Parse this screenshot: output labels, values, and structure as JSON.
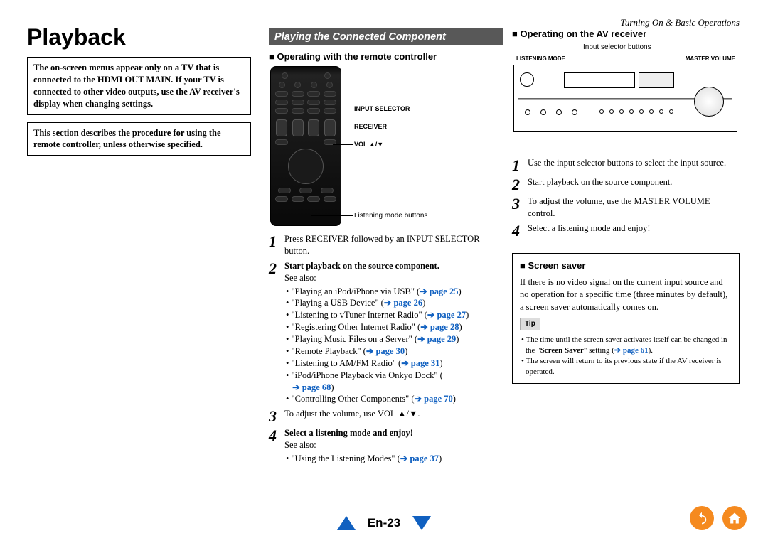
{
  "header": {
    "breadcrumb": "Turning On & Basic Operations"
  },
  "title": "Playback",
  "col1": {
    "box1_a": "The on-screen menus appear only on a TV that is connected to the ",
    "box1_b": "HDMI OUT MAIN",
    "box1_c": ". If your TV is connected to other video outputs, use the AV receiver's display when changing settings.",
    "box2": "This section describes the procedure for using the remote controller, unless otherwise specified."
  },
  "col2": {
    "section_title": "Playing the Connected Component",
    "subheading": "Operating with the remote controller",
    "callouts": {
      "input_selector": "INPUT SELECTOR",
      "receiver": "RECEIVER",
      "vol": "VOL ▲/▼",
      "listening": "Listening mode buttons"
    },
    "steps": [
      {
        "bold_a": "Press ",
        "bold_b": "RECEIVER",
        "bold_c": " followed by an ",
        "bold_d": "INPUT SELECTOR",
        "bold_e": " button."
      },
      {
        "bold": "Start playback on the source component.",
        "after": "See also:",
        "links": [
          {
            "text": "\"Playing an iPod/iPhone via USB\" (",
            "p": "page 25",
            "close": ")"
          },
          {
            "text": "\"Playing a USB Device\" (",
            "p": "page 26",
            "close": ")"
          },
          {
            "text": "\"Listening to vTuner Internet Radio\" (",
            "p": "page 27",
            "close": ")"
          },
          {
            "text": "\"Registering Other Internet Radio\" (",
            "p": "page 28",
            "close": ")"
          },
          {
            "text": "\"Playing Music Files on a Server\" (",
            "p": "page 29",
            "close": ")"
          },
          {
            "text": "\"Remote Playback\" (",
            "p": "page 30",
            "close": ")"
          },
          {
            "text": "\"Listening to AM/FM Radio\" (",
            "p": "page 31",
            "close": ")"
          },
          {
            "text": "\"iPod/iPhone Playback via Onkyo Dock\" (",
            "p": "page 68",
            "close": ")"
          },
          {
            "text": "\"Controlling Other Components\" (",
            "p": "page 70",
            "close": ")"
          }
        ]
      },
      {
        "bold_a": "To adjust the volume, use ",
        "bold_b": "VOL ▲/▼",
        "bold_c": "."
      },
      {
        "bold": "Select a listening mode and enjoy!",
        "after": "See also:",
        "links": [
          {
            "text": "\"Using the Listening Modes\" (",
            "p": "page 37",
            "close": ")"
          }
        ]
      }
    ]
  },
  "col3": {
    "subheading": "Operating on the AV receiver",
    "labels": {
      "input_buttons": "Input selector buttons",
      "listening_mode": "LISTENING MODE",
      "master_volume": "MASTER VOLUME"
    },
    "steps": [
      {
        "bold": "Use the input selector buttons to select the input source."
      },
      {
        "bold": "Start playback on the source component."
      },
      {
        "bold_a": "To adjust the volume, use the ",
        "bold_b": "MASTER VOLUME",
        "bold_c": " control."
      },
      {
        "bold": "Select a listening mode and enjoy!"
      }
    ],
    "screensaver": {
      "heading": "Screen saver",
      "body": "If there is no video signal on the current input source and no operation for a specific time (three minutes by default), a screen saver automatically comes on.",
      "tip_label": "Tip",
      "bullets": [
        {
          "a": "The time until the screen saver activates itself can be changed in the \"",
          "b": "Screen Saver",
          "c": "\" setting (",
          "p": "page 61",
          "d": ")."
        },
        {
          "a": "The screen will return to its previous state if the AV receiver is operated."
        }
      ]
    }
  },
  "footer": {
    "page": "En-23"
  }
}
